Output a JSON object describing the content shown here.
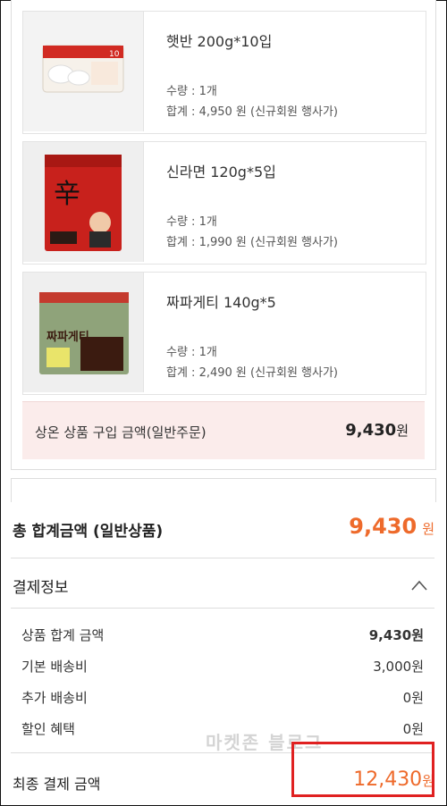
{
  "items": [
    {
      "name": "햇반 200g*10입",
      "qty": "수량 : 1개",
      "total": "합계 : 4,950 원 (신규회원 행사가)",
      "thumb_text": "10",
      "thumb_bg": "#f3ece3",
      "pack": "#e8e4dc",
      "accent": "#d12a22"
    },
    {
      "name": "신라면 120g*5입",
      "qty": "수량 : 1개",
      "total": "합계 : 1,990 원 (신규회원 행사가)",
      "thumb_text": "辛",
      "thumb_bg": "#efefef",
      "pack": "#c8211c",
      "accent": "#1a1a1a"
    },
    {
      "name": "짜파게티 140g*5",
      "qty": "수량 : 1개",
      "total": "합계 : 2,490 원 (신규회원 행사가)",
      "thumb_text": "짜파게티",
      "thumb_bg": "#efefef",
      "pack": "#8fa37a",
      "accent": "#3b1b10"
    }
  ],
  "subtotal": {
    "label": "상온 상품 구입 금액(일반주문)",
    "value": "9,430",
    "unit": "원"
  },
  "grand": {
    "label": "총 합계금액 (일반상품)",
    "value": "9,430",
    "unit": "원"
  },
  "payment": {
    "title": "결제정보",
    "rows": [
      {
        "label": "상품 합계 금액",
        "value": "9,430원"
      },
      {
        "label": "기본 배송비",
        "value": "3,000원"
      },
      {
        "label": "추가 배송비",
        "value": "0원"
      },
      {
        "label": "할인 혜택",
        "value": "0원"
      }
    ]
  },
  "final": {
    "label": "최종 결제 금액",
    "value": "12,430",
    "unit": "원"
  },
  "watermark": "마켓존 블로그",
  "colors": {
    "accent": "#ee6a2b",
    "highlight": "#e02121",
    "subtotal_bg": "#fbeceb"
  }
}
